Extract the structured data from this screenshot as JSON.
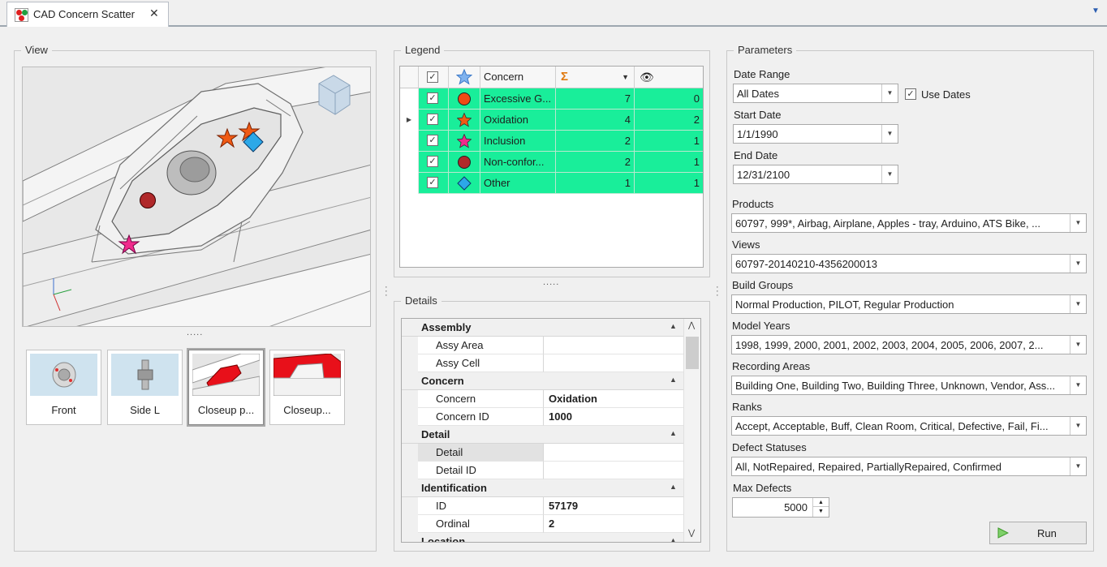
{
  "tab": {
    "title": "CAD Concern Scatter",
    "close_glyph": "✕",
    "menu_glyph": "▼"
  },
  "view": {
    "title": "View",
    "splitter": ".....",
    "thumbnails": [
      {
        "label": "Front"
      },
      {
        "label": "Side L"
      },
      {
        "label": "Closeup p..."
      },
      {
        "label": "Closeup..."
      }
    ]
  },
  "legend": {
    "title": "Legend",
    "columns": {
      "concern": "Concern"
    },
    "rows": [
      {
        "concern": "Excessive G...",
        "total": "7",
        "visible": "0",
        "shape": "circle",
        "color": "#f04a14"
      },
      {
        "concern": "Oxidation",
        "total": "4",
        "visible": "2",
        "shape": "star",
        "color": "#f05a14"
      },
      {
        "concern": "Inclusion",
        "total": "2",
        "visible": "1",
        "shape": "star",
        "color": "#f02a8c"
      },
      {
        "concern": "Non-confor...",
        "total": "2",
        "visible": "1",
        "shape": "circle",
        "color": "#b0282a"
      },
      {
        "concern": "Other",
        "total": "1",
        "visible": "1",
        "shape": "diamond",
        "color": "#2ca8e8"
      }
    ],
    "splitter": "....."
  },
  "details": {
    "title": "Details",
    "sections": [
      {
        "name": "Assembly",
        "rows": [
          {
            "label": "Assy Area",
            "value": ""
          },
          {
            "label": "Assy Cell",
            "value": ""
          }
        ]
      },
      {
        "name": "Concern",
        "rows": [
          {
            "label": "Concern",
            "value": "Oxidation"
          },
          {
            "label": "Concern ID",
            "value": "1000"
          }
        ]
      },
      {
        "name": "Detail",
        "rows": [
          {
            "label": "Detail",
            "value": ""
          },
          {
            "label": "Detail ID",
            "value": ""
          }
        ]
      },
      {
        "name": "Identification",
        "rows": [
          {
            "label": "ID",
            "value": "57179"
          },
          {
            "label": "Ordinal",
            "value": "2"
          }
        ]
      },
      {
        "name": "Location",
        "rows": []
      }
    ]
  },
  "parameters": {
    "title": "Parameters",
    "date_range": {
      "label": "Date Range",
      "value": "All Dates"
    },
    "use_dates": {
      "label": "Use Dates",
      "checked": true
    },
    "start_date": {
      "label": "Start Date",
      "value": "1/1/1990"
    },
    "end_date": {
      "label": "End Date",
      "value": "12/31/2100"
    },
    "products": {
      "label": "Products",
      "value": "60797, 999*, Airbag, Airplane, Apples - tray, Arduino, ATS Bike, ..."
    },
    "views": {
      "label": "Views",
      "value": "60797-20140210-4356200013"
    },
    "build_groups": {
      "label": "Build Groups",
      "value": "Normal Production, PILOT, Regular Production"
    },
    "model_years": {
      "label": "Model Years",
      "value": "1998, 1999, 2000, 2001, 2002, 2003, 2004, 2005, 2006, 2007, 2..."
    },
    "recording_areas": {
      "label": "Recording Areas",
      "value": "Building One, Building Two, Building Three, Unknown, Vendor, Ass..."
    },
    "ranks": {
      "label": "Ranks",
      "value": "Accept, Acceptable, Buff, Clean Room, Critical, Defective, Fail, Fi..."
    },
    "defect_statuses": {
      "label": "Defect Statuses",
      "value": "All, NotRepaired, Repaired, PartiallyRepaired, Confirmed"
    },
    "max_defects": {
      "label": "Max Defects",
      "value": "5000"
    },
    "run_label": "Run"
  }
}
